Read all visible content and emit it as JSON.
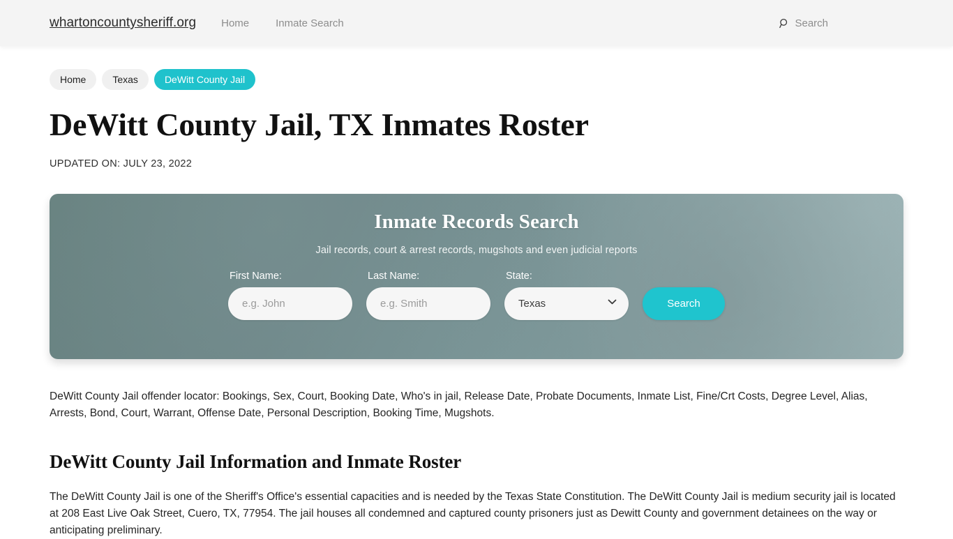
{
  "header": {
    "brand": "whartoncountysheriff.org",
    "nav": [
      {
        "label": "Home"
      },
      {
        "label": "Inmate Search"
      }
    ],
    "search_label": "Search",
    "search_icon": "search-icon"
  },
  "breadcrumb": [
    {
      "label": "Home",
      "active": false
    },
    {
      "label": "Texas",
      "active": false
    },
    {
      "label": "DeWitt County Jail",
      "active": true
    }
  ],
  "page": {
    "title": "DeWitt County Jail, TX Inmates Roster",
    "updated": "UPDATED ON: JULY 23, 2022"
  },
  "search_panel": {
    "title": "Inmate Records Search",
    "subtitle": "Jail records, court & arrest records, mugshots and even judicial reports",
    "first_name": {
      "label": "First Name:",
      "placeholder": "e.g. John",
      "value": ""
    },
    "last_name": {
      "label": "Last Name:",
      "placeholder": "e.g. Smith",
      "value": ""
    },
    "state": {
      "label": "State:",
      "selected": "Texas",
      "chevron_icon": "chevron-down-icon"
    },
    "submit_label": "Search"
  },
  "content": {
    "lead": "DeWitt County Jail offender locator: Bookings, Sex, Court, Booking Date, Who's in jail, Release Date, Probate Documents, Inmate List, Fine/Crt Costs, Degree Level, Alias, Arrests, Bond, Court, Warrant, Offense Date, Personal Description, Booking Time, Mugshots.",
    "section_heading": "DeWitt County Jail Information and Inmate Roster",
    "paragraph": "The DeWitt County Jail is one of the Sheriff's Office's essential capacities and is needed by the Texas State Constitution. The DeWitt County Jail is medium security jail is located at 208 East Live Oak Street, Cuero, TX, 77954. The jail houses all condemned and captured county prisoners just as Dewitt County and government detainees on the way or anticipating preliminary."
  },
  "colors": {
    "accent_teal": "#1fc4ce",
    "header_bg": "#f4f4f4",
    "panel_dark": "#67817f",
    "panel_light": "#93acae",
    "text_dark": "#252525",
    "text_muted": "#8d8d8d"
  }
}
